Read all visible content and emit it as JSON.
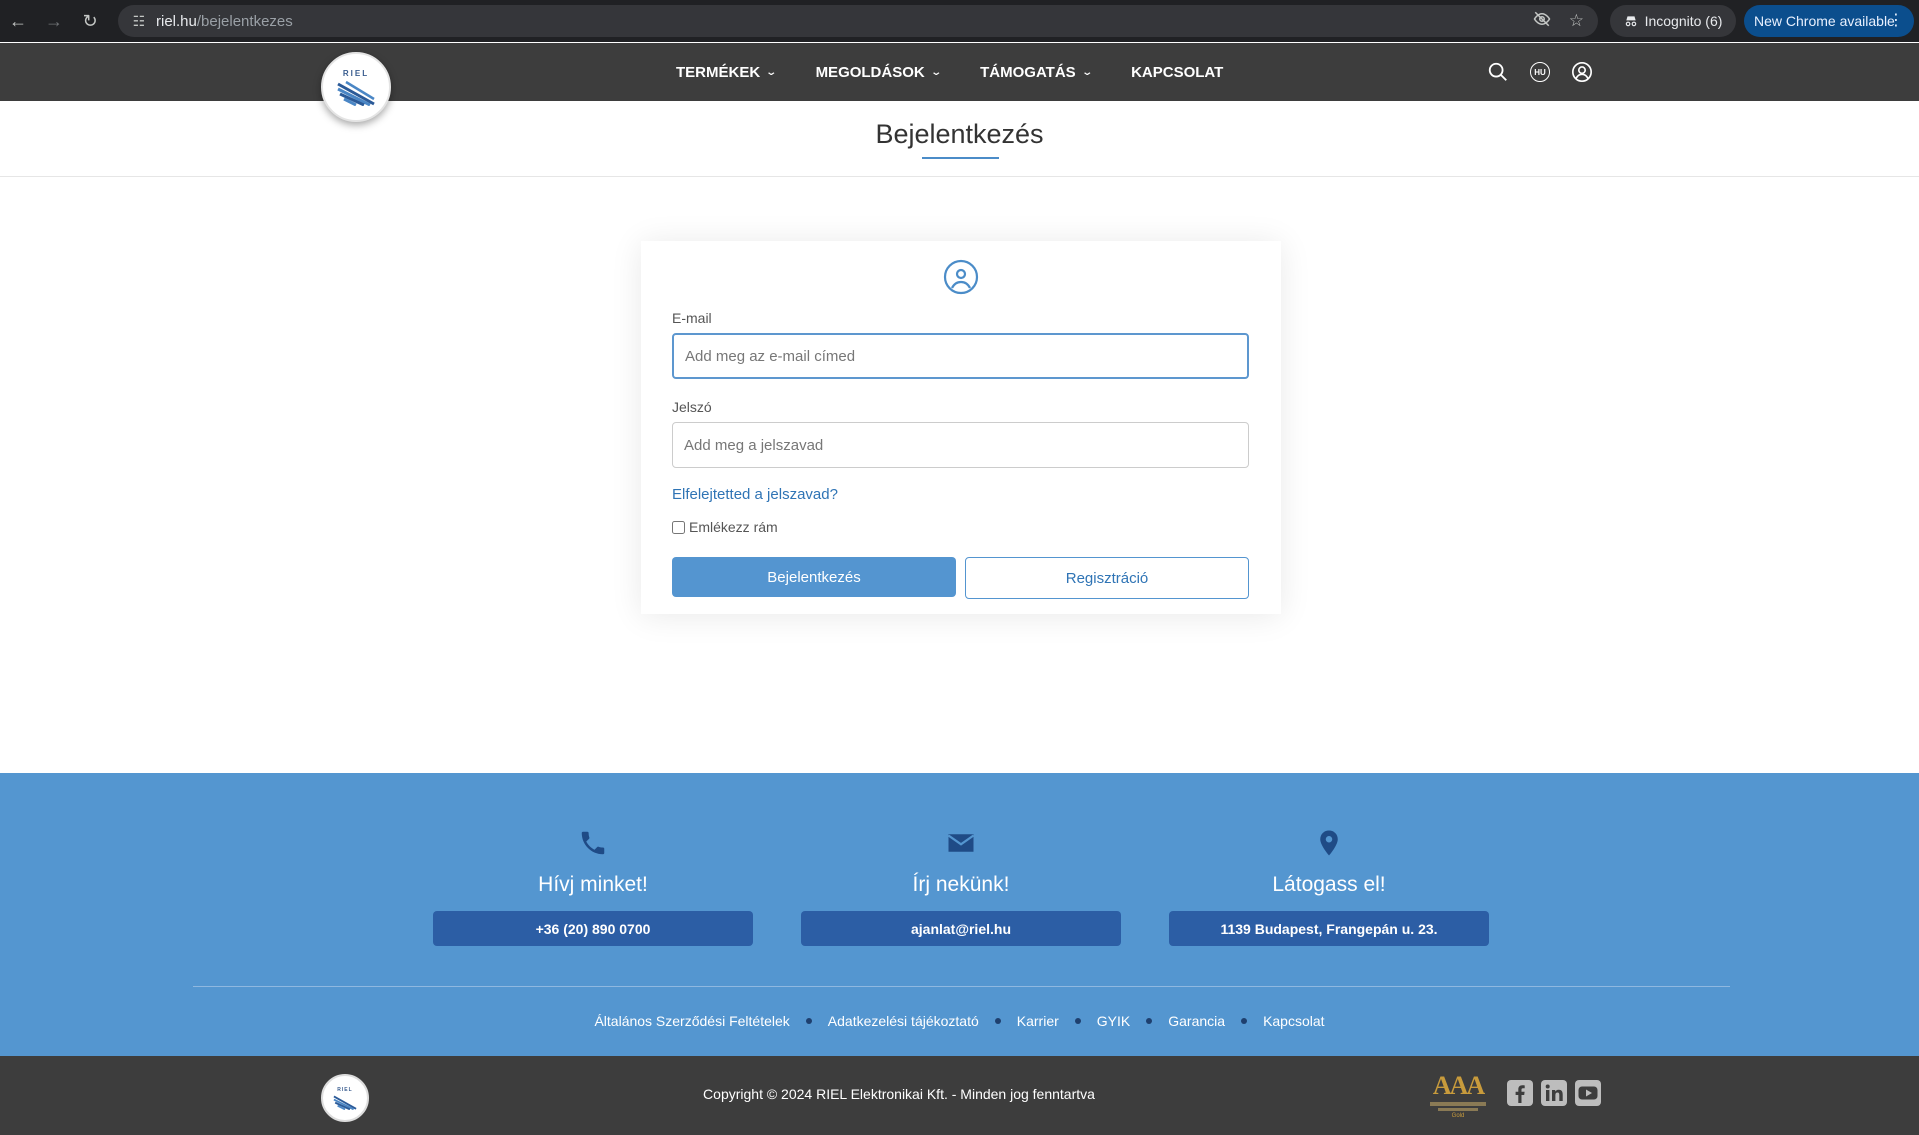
{
  "browser": {
    "url_domain": "riel.hu",
    "url_path": "/bejelentkezes",
    "incognito_label": "Incognito (6)",
    "update_label": "New Chrome available"
  },
  "header": {
    "logo_text": "RIEL",
    "nav": [
      {
        "label": "TERMÉKEK",
        "has_dropdown": true
      },
      {
        "label": "MEGOLDÁSOK",
        "has_dropdown": true
      },
      {
        "label": "TÁMOGATÁS",
        "has_dropdown": true
      },
      {
        "label": "KAPCSOLAT",
        "has_dropdown": false
      }
    ],
    "icons": [
      "search-icon",
      "language-icon",
      "account-icon"
    ],
    "language_code": "HU"
  },
  "page": {
    "title": "Bejelentkezés"
  },
  "login": {
    "email_label": "E-mail",
    "email_placeholder": "Add meg az e-mail címed",
    "email_value": "",
    "password_label": "Jelszó",
    "password_placeholder": "Add meg a jelszavad",
    "password_value": "",
    "forgot_link": "Elfelejtetted a jelszavad?",
    "remember_label": "Emlékezz rám",
    "remember_checked": false,
    "login_button": "Bejelentkezés",
    "register_button": "Regisztráció"
  },
  "contacts": [
    {
      "icon": "phone-icon",
      "title": "Hívj minket!",
      "value": "+36 (20) 890 0700"
    },
    {
      "icon": "envelope-icon",
      "title": "Írj nekünk!",
      "value": "ajanlat@riel.hu"
    },
    {
      "icon": "map-pin-icon",
      "title": "Látogass el!",
      "value": "1139 Budapest, Frangepán u. 23."
    }
  ],
  "footer_links": [
    "Általános Szerződési Feltételek",
    "Adatkezelési tájékoztató",
    "Karrier",
    "GYIK",
    "Garancia",
    "Kapcsolat"
  ],
  "footer": {
    "copyright": "Copyright © 2024 RIEL Elektronikai Kft. - Minden jog fenntartva",
    "badge_text": "AAA",
    "badge_gold": "Gold",
    "socials": [
      "facebook-icon",
      "linkedin-icon",
      "youtube-icon"
    ]
  },
  "colors": {
    "brand_blue": "#5496d0",
    "button_dark_blue": "#2c5ea5",
    "header_dark": "#3d3d3d",
    "link_blue": "#2f74b5"
  }
}
